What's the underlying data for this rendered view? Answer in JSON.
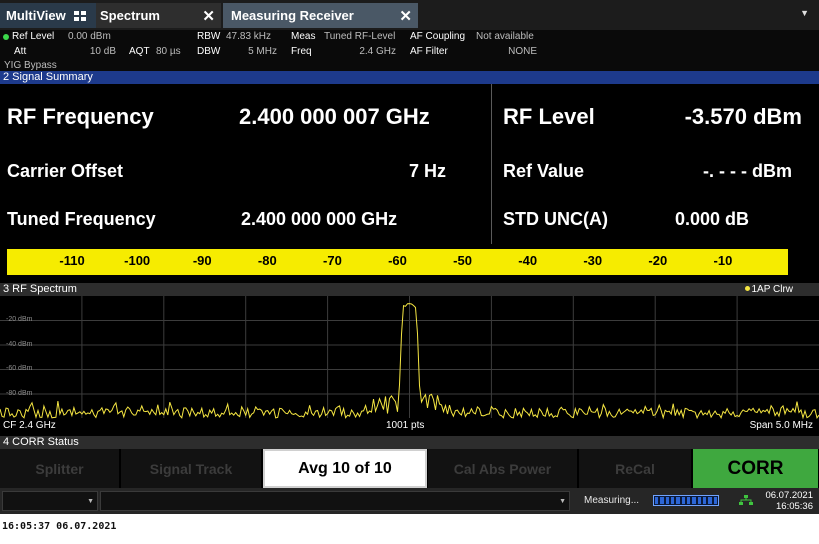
{
  "tabs": {
    "multiview": "MultiView",
    "spectrum": "Spectrum",
    "measuring_receiver": "Measuring Receiver",
    "close_symbol": "✕"
  },
  "settings": {
    "ref_level_label": "Ref Level",
    "ref_level_value": "0.00 dBm",
    "att_label": "Att",
    "att_value": "10 dB",
    "aqt_label": "AQT",
    "aqt_value": "80 µs",
    "rbw_label": "RBW",
    "rbw_value": "47.83 kHz",
    "dbw_label": "DBW",
    "dbw_value": "5 MHz",
    "meas_label": "Meas",
    "meas_value": "Tuned RF-Level",
    "freq_label": "Freq",
    "freq_value": "2.4 GHz",
    "af_coupling_label": "AF Coupling",
    "af_coupling_value": "Not available",
    "af_filter_label": "AF Filter",
    "af_filter_value": "NONE",
    "yig_bypass": "YIG Bypass"
  },
  "signal_summary": {
    "title": "2 Signal Summary",
    "rf_frequency_label": "RF Frequency",
    "rf_frequency_value": "2.400 000 007 GHz",
    "rf_level_label": "RF Level",
    "rf_level_value": "-3.570 dBm",
    "carrier_offset_label": "Carrier Offset",
    "carrier_offset_value": "7 Hz",
    "ref_value_label": "Ref Value",
    "ref_value_value": "-. - - - dBm",
    "tuned_frequency_label": "Tuned Frequency",
    "tuned_frequency_value": "2.400 000 000 GHz",
    "std_unc_label": "STD UNC(A)",
    "std_unc_value": "0.000 dB",
    "level_bar": {
      "ticks": [
        "-110",
        "-100",
        "-90",
        "-80",
        "-70",
        "-60",
        "-50",
        "-40",
        "-30",
        "-20",
        "-10"
      ],
      "range_db": [
        -120,
        0
      ],
      "fill_level_db": -3.57
    }
  },
  "rf_spectrum": {
    "title": "3 RF Spectrum",
    "trace_legend": "1AP Clrw",
    "y_ticks": [
      "-20 dBm",
      "-40 dBm",
      "-60 dBm",
      "-80 dBm"
    ],
    "cf_label": "CF 2.4 GHz",
    "points_label": "1001 pts",
    "span_label": "Span 5.0 MHz",
    "trace_color": "#f5e642"
  },
  "corr_status": {
    "title": "4 CORR Status",
    "buttons": {
      "splitter": "Splitter",
      "signal_track": "Signal Track",
      "avg": "Avg 10 of 10",
      "cal_abs_power": "Cal Abs Power",
      "recal": "ReCal",
      "corr": "CORR"
    },
    "corr_color": "#3fa83f"
  },
  "status_bar": {
    "measuring": "Measuring...",
    "date": "06.07.2021",
    "time": "16:05:36"
  },
  "footer_timestamp": "16:05:37  06.07.2021"
}
